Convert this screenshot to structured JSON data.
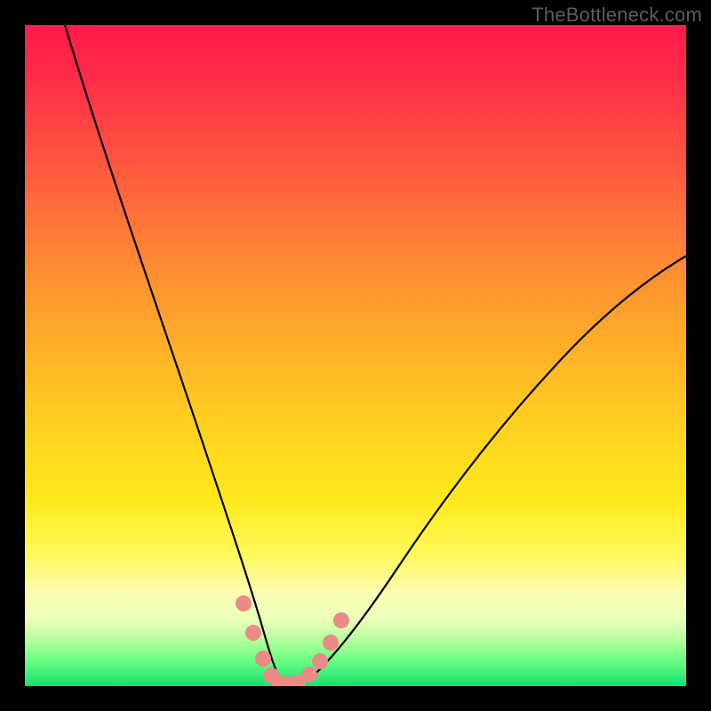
{
  "watermark": "TheBottleneck.com",
  "colors": {
    "frame": "#000000",
    "curve": "#000000",
    "marker_fill": "#eb8a86",
    "marker_stroke": "#eb8a86",
    "gradient_top": "#ff1a4b",
    "gradient_bottom": "#15e26e"
  },
  "chart_data": {
    "type": "line",
    "title": "",
    "xlabel": "",
    "ylabel": "",
    "x_range": [
      0,
      100
    ],
    "y_range": [
      0,
      100
    ],
    "note": "No axis ticks rendered; values are estimated percentages of plot width/height. y=0 at bottom (minimum bottleneck), y=100 at top.",
    "series": [
      {
        "name": "bottleneck-curve",
        "x": [
          6,
          10,
          14,
          18,
          22,
          26,
          29,
          32,
          34,
          36,
          37,
          38,
          40,
          43,
          47,
          52,
          58,
          65,
          73,
          82,
          92,
          100
        ],
        "y": [
          100,
          86,
          72,
          59,
          47,
          35,
          25,
          16,
          9,
          4,
          1,
          0,
          0,
          2,
          6,
          12,
          20,
          29,
          38,
          47,
          56,
          63
        ]
      }
    ],
    "markers": {
      "name": "highlighted-points",
      "x": [
        33.0,
        34.5,
        36.0,
        37.0,
        38.0,
        39.5,
        41.0,
        43.0,
        44.5,
        46.2,
        47.5
      ],
      "y": [
        12.5,
        8.0,
        4.0,
        1.5,
        0.5,
        0.3,
        0.5,
        1.8,
        4.0,
        7.0,
        10.0
      ]
    }
  }
}
